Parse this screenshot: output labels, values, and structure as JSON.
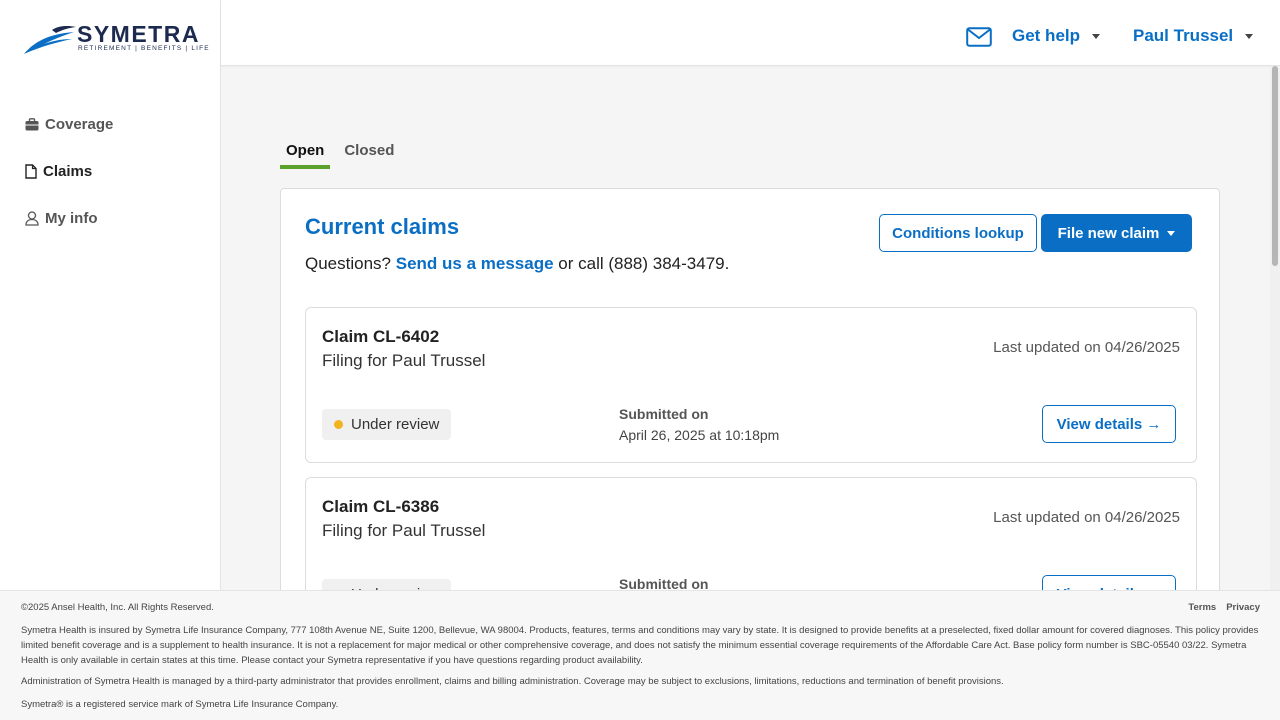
{
  "brand": {
    "name": "SYMETRA",
    "tagline": "RETIREMENT | BENEFITS | LIFE"
  },
  "sidebar": {
    "items": [
      {
        "label": "Coverage",
        "icon": "briefcase-icon"
      },
      {
        "label": "Claims",
        "icon": "document-icon"
      },
      {
        "label": "My info",
        "icon": "user-icon"
      }
    ]
  },
  "header": {
    "help_label": "Get help",
    "user_label": "Paul Trussel",
    "mail_icon": "mail-icon"
  },
  "tabs": [
    {
      "label": "Open",
      "active": true
    },
    {
      "label": "Closed",
      "active": false
    }
  ],
  "panel": {
    "title": "Current claims",
    "questions_prefix": "Questions?",
    "message_link": "Send us a message",
    "call_text": "or call (888) 384-3479.",
    "conditions_button": "Conditions lookup",
    "file_claim_button": "File new claim"
  },
  "claims": [
    {
      "id": "Claim CL-6402",
      "filing": "Filing for Paul Trussel",
      "updated": "Last updated on 04/26/2025",
      "status": "Under review",
      "submitted_label": "Submitted on",
      "submitted_value": "April 26, 2025 at 10:18pm",
      "details_button": "View details →"
    },
    {
      "id": "Claim CL-6386",
      "filing": "Filing for Paul Trussel",
      "updated": "Last updated on 04/26/2025",
      "status": "Under review",
      "submitted_label": "Submitted on",
      "submitted_value": "",
      "details_button": "View details →"
    }
  ],
  "footer": {
    "copyright": "©2025 Ansel Health, Inc. All Rights Reserved.",
    "terms": "Terms",
    "privacy": "Privacy",
    "disclaimer": "Symetra Health is insured by Symetra Life Insurance Company, 777 108th Avenue NE, Suite 1200, Bellevue, WA 98004. Products, features, terms and conditions may vary by state. It is designed to provide benefits at a preselected, fixed dollar amount for covered diagnoses. This policy provides limited benefit coverage and is a supplement to health insurance. It is not a replacement for major medical or other comprehensive coverage, and does not satisfy the minimum essential coverage requirements of the Affordable Care Act. Base policy form number is SBC-05540 03/22. Symetra Health is only available in certain states at this time. Please contact your Symetra representative if you have questions regarding product availability.",
    "admin": "Administration of Symetra Health is managed by a third-party administrator that provides enrollment, claims and billing administration. Coverage may be subject to exclusions, limitations, reductions and termination of benefit provisions.",
    "service_mark": "Symetra® is a registered service mark of Symetra Life Insurance Company."
  },
  "colors": {
    "accent": "#0a6fc4",
    "tab_underline": "#5aa02c",
    "status_dot": "#f2b321"
  }
}
